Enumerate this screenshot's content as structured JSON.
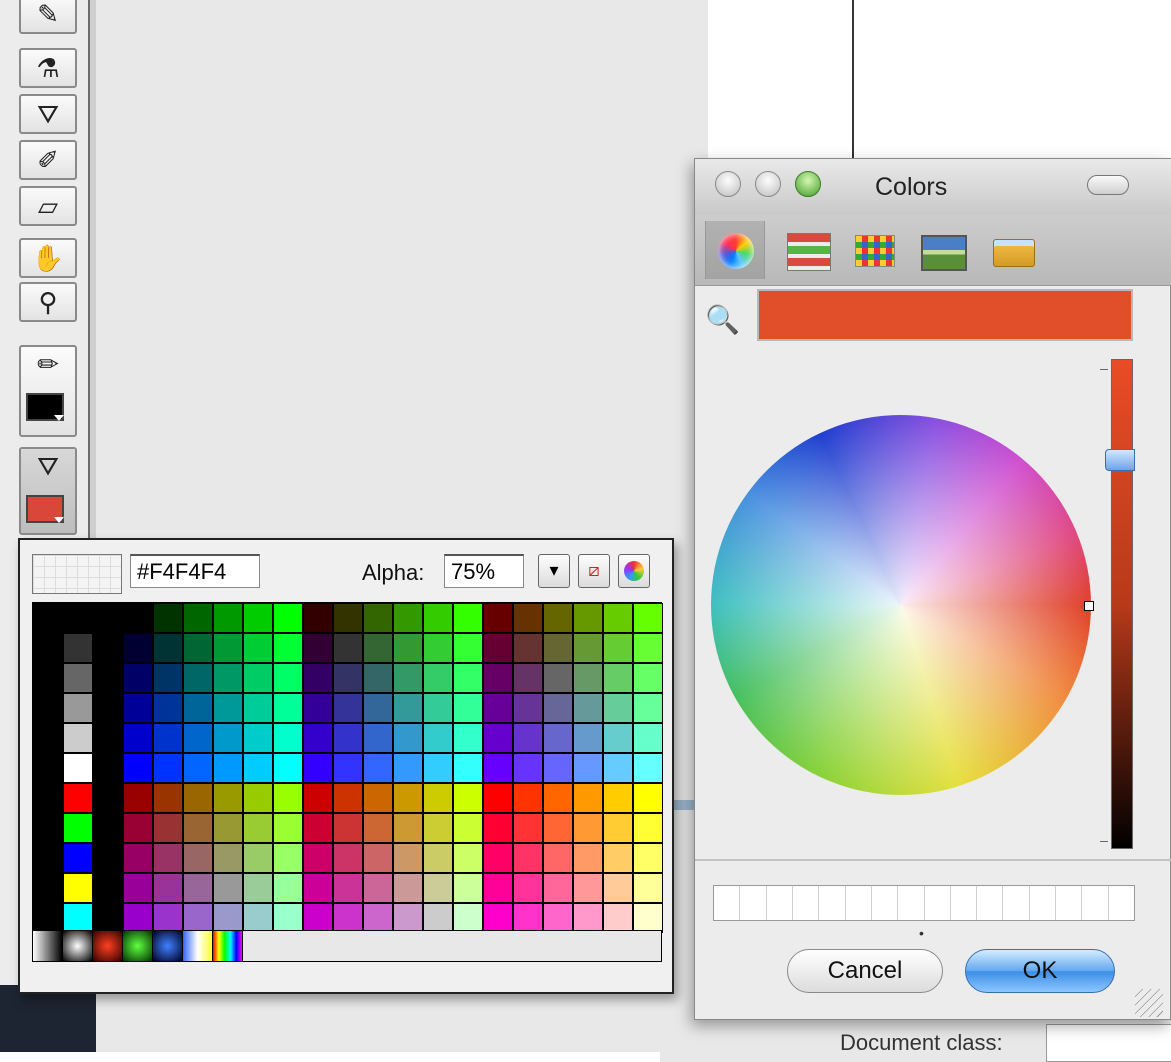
{
  "toolbar": {
    "tools": [
      "brush-tool",
      "ink-bottle-tool",
      "paint-bucket-tool",
      "eyedropper-tool",
      "eraser-tool",
      "hand-tool",
      "zoom-tool",
      "pencil-stroke-tool",
      "fill-bucket-tool"
    ],
    "stroke_color": "#000000",
    "fill_color": "#d9473a"
  },
  "properties": {
    "document_class_label": "Document class:"
  },
  "swatch_panel": {
    "hex_value": "#F4F4F4",
    "alpha_label": "Alpha:",
    "alpha_value": "75%",
    "no_color_icon": "no-color-icon",
    "color_picker_icon": "color-wheel-icon"
  },
  "colors_window": {
    "title": "Colors",
    "tabs": [
      "color-wheel",
      "color-sliders",
      "color-palettes",
      "image-palettes",
      "crayons"
    ],
    "current_color": "#e04e2a",
    "cancel_label": "Cancel",
    "ok_label": "OK"
  }
}
